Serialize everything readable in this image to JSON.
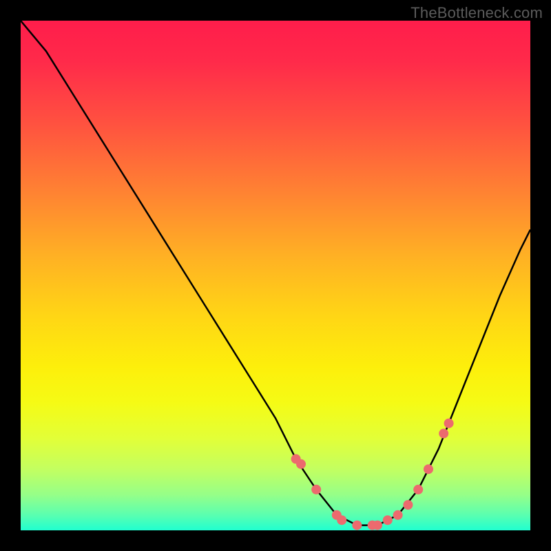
{
  "watermark": "TheBottleneck.com",
  "colors": {
    "frame": "#000000",
    "curve": "#000000",
    "dot_fill": "#ec6a6e",
    "gradient_top": "#ff1d4b",
    "gradient_bottom": "#20ffd0"
  },
  "chart_data": {
    "type": "line",
    "title": "",
    "xlabel": "",
    "ylabel": "",
    "xlim": [
      0,
      100
    ],
    "ylim": [
      0,
      100
    ],
    "curve": {
      "name": "bottleneck-curve",
      "x": [
        0,
        5,
        10,
        15,
        20,
        25,
        30,
        35,
        40,
        45,
        50,
        54,
        58,
        62,
        66,
        70,
        74,
        78,
        82,
        86,
        90,
        94,
        98,
        100
      ],
      "y": [
        100,
        94,
        86,
        78,
        70,
        62,
        54,
        46,
        38,
        30,
        22,
        14,
        8,
        3,
        1,
        1,
        3,
        8,
        16,
        26,
        36,
        46,
        55,
        59
      ]
    },
    "highlight_dots": {
      "name": "sample-points",
      "x": [
        54,
        55,
        58,
        62,
        63,
        66,
        69,
        70,
        72,
        74,
        76,
        78,
        80,
        83,
        84
      ],
      "y": [
        14,
        13,
        8,
        3,
        2,
        1,
        1,
        1,
        2,
        3,
        5,
        8,
        12,
        19,
        21
      ]
    }
  }
}
